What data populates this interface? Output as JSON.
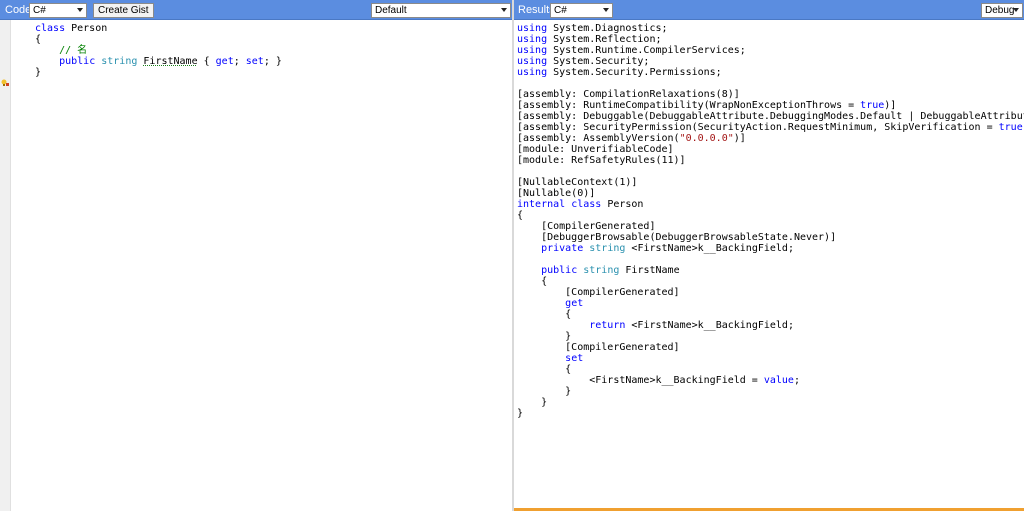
{
  "left_pane": {
    "title": "Code",
    "language_select": "C#",
    "create_gist_label": "Create Gist",
    "mode_select": "Default",
    "code_lines": [
      [
        {
          "t": "class ",
          "c": "kw"
        },
        {
          "t": "Person",
          "c": ""
        }
      ],
      [
        {
          "t": "{",
          "c": ""
        }
      ],
      [
        {
          "t": "    // 名",
          "c": "cm"
        }
      ],
      [
        {
          "t": "    ",
          "c": ""
        },
        {
          "t": "public ",
          "c": "kw"
        },
        {
          "t": "string ",
          "c": "ty"
        },
        {
          "t": "FirstName",
          "c": "u"
        },
        {
          "t": " { ",
          "c": ""
        },
        {
          "t": "get",
          "c": "kw"
        },
        {
          "t": "; ",
          "c": ""
        },
        {
          "t": "set",
          "c": "kw"
        },
        {
          "t": "; }",
          "c": ""
        }
      ],
      [
        {
          "t": "}",
          "c": ""
        }
      ]
    ]
  },
  "right_pane": {
    "title": "Results",
    "language_select": "C#",
    "config_select": "Debug",
    "code_lines": [
      [
        {
          "t": "using ",
          "c": "kw"
        },
        {
          "t": "System.Diagnostics;",
          "c": ""
        }
      ],
      [
        {
          "t": "using ",
          "c": "kw"
        },
        {
          "t": "System.Reflection;",
          "c": ""
        }
      ],
      [
        {
          "t": "using ",
          "c": "kw"
        },
        {
          "t": "System.Runtime.CompilerServices;",
          "c": ""
        }
      ],
      [
        {
          "t": "using ",
          "c": "kw"
        },
        {
          "t": "System.Security;",
          "c": ""
        }
      ],
      [
        {
          "t": "using ",
          "c": "kw"
        },
        {
          "t": "System.Security.Permissions;",
          "c": ""
        }
      ],
      [
        {
          "t": "",
          "c": ""
        }
      ],
      [
        {
          "t": "[assembly: CompilationRelaxations(8)]",
          "c": ""
        }
      ],
      [
        {
          "t": "[assembly: RuntimeCompatibility(WrapNonExceptionThrows = ",
          "c": ""
        },
        {
          "t": "true",
          "c": "kw"
        },
        {
          "t": ")]",
          "c": ""
        }
      ],
      [
        {
          "t": "[assembly: Debuggable(DebuggableAttribute.DebuggingModes.Default | DebuggableAttribute.DebuggingModes.DisableOptimizations)]",
          "c": ""
        }
      ],
      [
        {
          "t": "[assembly: SecurityPermission(SecurityAction.RequestMinimum, SkipVerification = ",
          "c": ""
        },
        {
          "t": "true",
          "c": "kw"
        },
        {
          "t": ")]",
          "c": ""
        }
      ],
      [
        {
          "t": "[assembly: AssemblyVersion(",
          "c": ""
        },
        {
          "t": "\"0.0.0.0\"",
          "c": "st"
        },
        {
          "t": ")]",
          "c": ""
        }
      ],
      [
        {
          "t": "[module: UnverifiableCode]",
          "c": ""
        }
      ],
      [
        {
          "t": "[module: RefSafetyRules(11)]",
          "c": ""
        }
      ],
      [
        {
          "t": "",
          "c": ""
        }
      ],
      [
        {
          "t": "[NullableContext(1)]",
          "c": ""
        }
      ],
      [
        {
          "t": "[Nullable(0)]",
          "c": ""
        }
      ],
      [
        {
          "t": "internal ",
          "c": "kw"
        },
        {
          "t": "class ",
          "c": "kw"
        },
        {
          "t": "Person",
          "c": ""
        }
      ],
      [
        {
          "t": "{",
          "c": ""
        }
      ],
      [
        {
          "t": "    [CompilerGenerated]",
          "c": ""
        }
      ],
      [
        {
          "t": "    [DebuggerBrowsable(DebuggerBrowsableState.Never)]",
          "c": ""
        }
      ],
      [
        {
          "t": "    ",
          "c": ""
        },
        {
          "t": "private ",
          "c": "kw"
        },
        {
          "t": "string ",
          "c": "ty"
        },
        {
          "t": "<FirstName>k__BackingField;",
          "c": ""
        }
      ],
      [
        {
          "t": "",
          "c": ""
        }
      ],
      [
        {
          "t": "    ",
          "c": ""
        },
        {
          "t": "public ",
          "c": "kw"
        },
        {
          "t": "string ",
          "c": "ty"
        },
        {
          "t": "FirstName",
          "c": ""
        }
      ],
      [
        {
          "t": "    {",
          "c": ""
        }
      ],
      [
        {
          "t": "        [CompilerGenerated]",
          "c": ""
        }
      ],
      [
        {
          "t": "        ",
          "c": ""
        },
        {
          "t": "get",
          "c": "kw"
        }
      ],
      [
        {
          "t": "        {",
          "c": ""
        }
      ],
      [
        {
          "t": "            ",
          "c": ""
        },
        {
          "t": "return ",
          "c": "kw"
        },
        {
          "t": "<FirstName>k__BackingField;",
          "c": ""
        }
      ],
      [
        {
          "t": "        }",
          "c": ""
        }
      ],
      [
        {
          "t": "        [CompilerGenerated]",
          "c": ""
        }
      ],
      [
        {
          "t": "        ",
          "c": ""
        },
        {
          "t": "set",
          "c": "kw"
        }
      ],
      [
        {
          "t": "        {",
          "c": ""
        }
      ],
      [
        {
          "t": "            <FirstName>k__BackingField = ",
          "c": ""
        },
        {
          "t": "value",
          "c": "kw"
        },
        {
          "t": ";",
          "c": ""
        }
      ],
      [
        {
          "t": "        }",
          "c": ""
        }
      ],
      [
        {
          "t": "    }",
          "c": ""
        }
      ],
      [
        {
          "t": "}",
          "c": ""
        }
      ]
    ]
  },
  "colors": {
    "toolbar": "#5b8de0",
    "keyword": "#0000ff",
    "type": "#2b91af",
    "comment": "#008000",
    "string": "#a31515",
    "status_bar": "#f0a030"
  },
  "icons": {
    "gutter_marker": "warning-lightbulb-icon"
  }
}
